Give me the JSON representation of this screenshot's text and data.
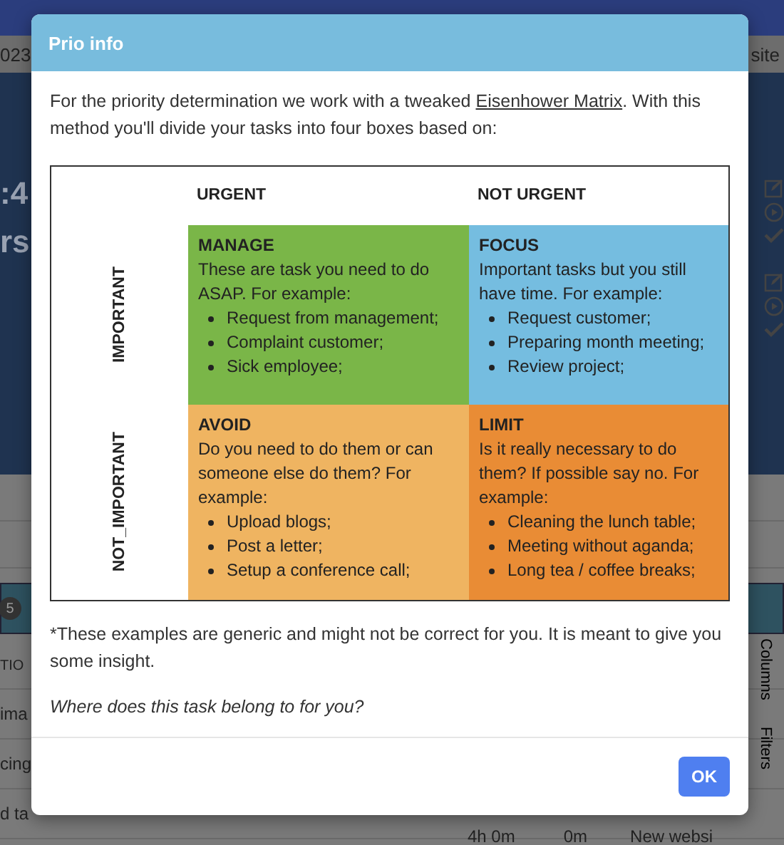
{
  "background": {
    "date_fragment": "023",
    "link_fragment": "site",
    "hero_fragments": [
      ":4",
      "rs"
    ],
    "badge": "5",
    "column_header": "TIO",
    "rows": [
      "ima",
      "cing",
      "d ta"
    ],
    "side_tabs": [
      "Columns",
      "Filters"
    ],
    "footer_cells": [
      "4h 0m",
      "0m",
      "New websi"
    ]
  },
  "dialog": {
    "title": "Prio info",
    "intro_before": "For the priority determination we work with a tweaked ",
    "intro_link": "Eisenhower Matrix",
    "intro_after": ". With this method you'll divide your tasks into four boxes based on:",
    "matrix": {
      "columns": [
        "URGENT",
        "NOT URGENT"
      ],
      "rows": [
        {
          "label": "IMPORTANT",
          "cells": [
            {
              "title": "MANAGE",
              "text": "These are task you need to do ASAP. For example:",
              "items": [
                "Request from management;",
                "Complaint customer;",
                "Sick employee;"
              ],
              "color": "#7ab648"
            },
            {
              "title": "FOCUS",
              "text": "Important tasks but you still have time. For example:",
              "items": [
                "Request customer;",
                "Preparing month meeting;",
                "Review project;"
              ],
              "color": "#75bde0"
            }
          ]
        },
        {
          "label": "NOT_IMPORTANT",
          "cells": [
            {
              "title": "AVOID",
              "text": "Do you need to do them or can someone else do them? For example:",
              "items": [
                "Upload blogs;",
                "Post a letter;",
                "Setup a conference call;"
              ],
              "color": "#efb461"
            },
            {
              "title": "LIMIT",
              "text": "Is it really necessary to do them? If possible say no. For example:",
              "items": [
                "Cleaning the lunch table;",
                "Meeting without aganda;",
                "Long tea / coffee breaks;"
              ],
              "color": "#e98c35"
            }
          ]
        }
      ]
    },
    "footnote": "*These examples are generic and might not be correct for you. It is meant to give you some insight.",
    "question": "Where does this task belong to for you?",
    "ok_button": "OK"
  }
}
